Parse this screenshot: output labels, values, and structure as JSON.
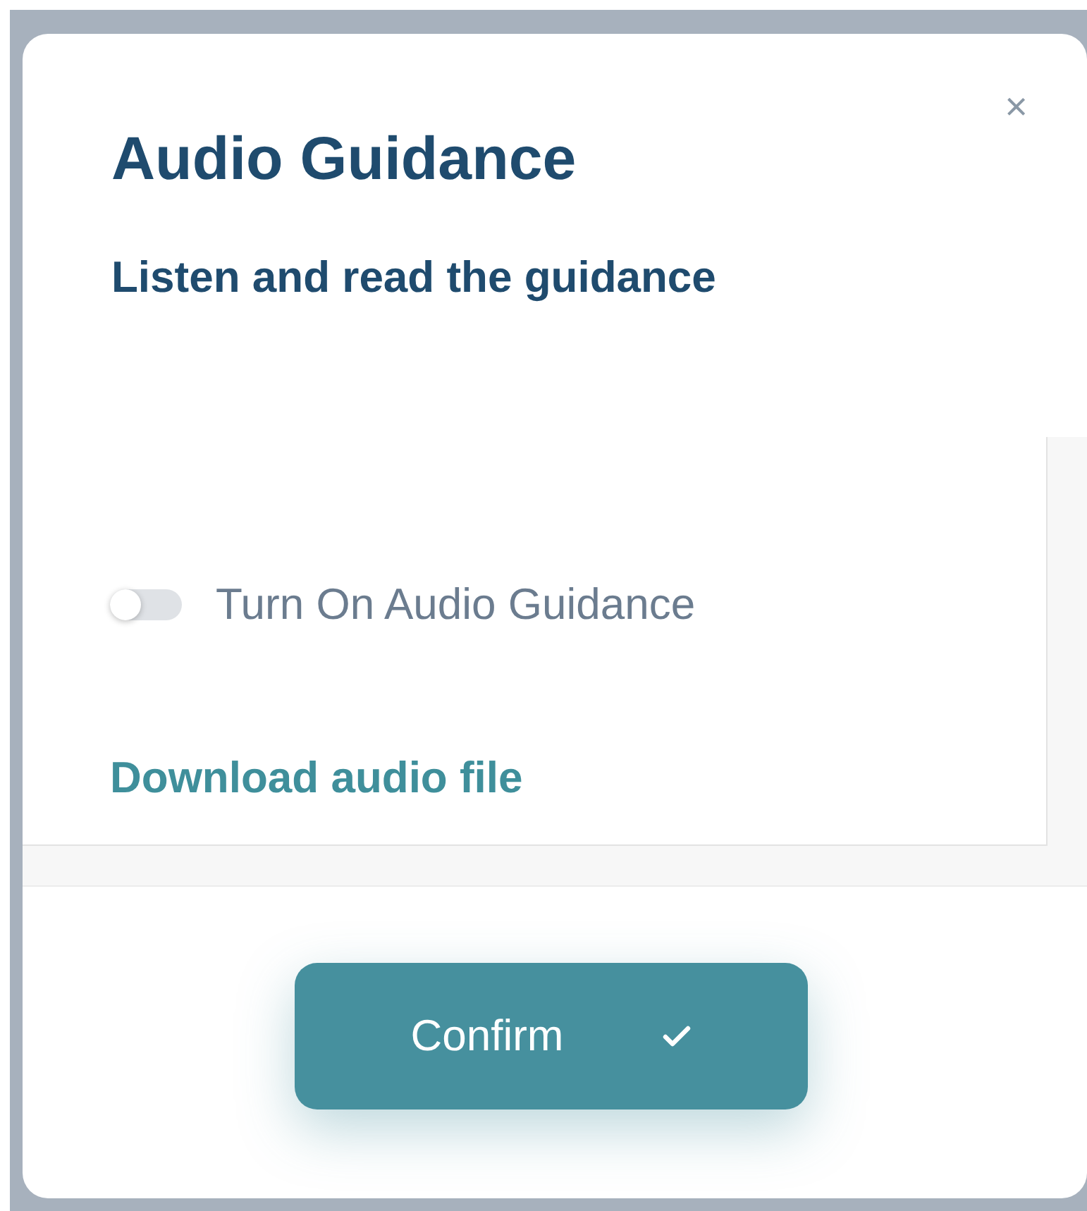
{
  "dialog": {
    "title": "Audio Guidance",
    "close": "×",
    "subtitle": "Listen and read the guidance",
    "audio_toggle": {
      "label": "Turn On Audio Guidance",
      "on": false
    },
    "download_link": "Download audio file",
    "confirm_button": {
      "label": "Confirm"
    }
  }
}
